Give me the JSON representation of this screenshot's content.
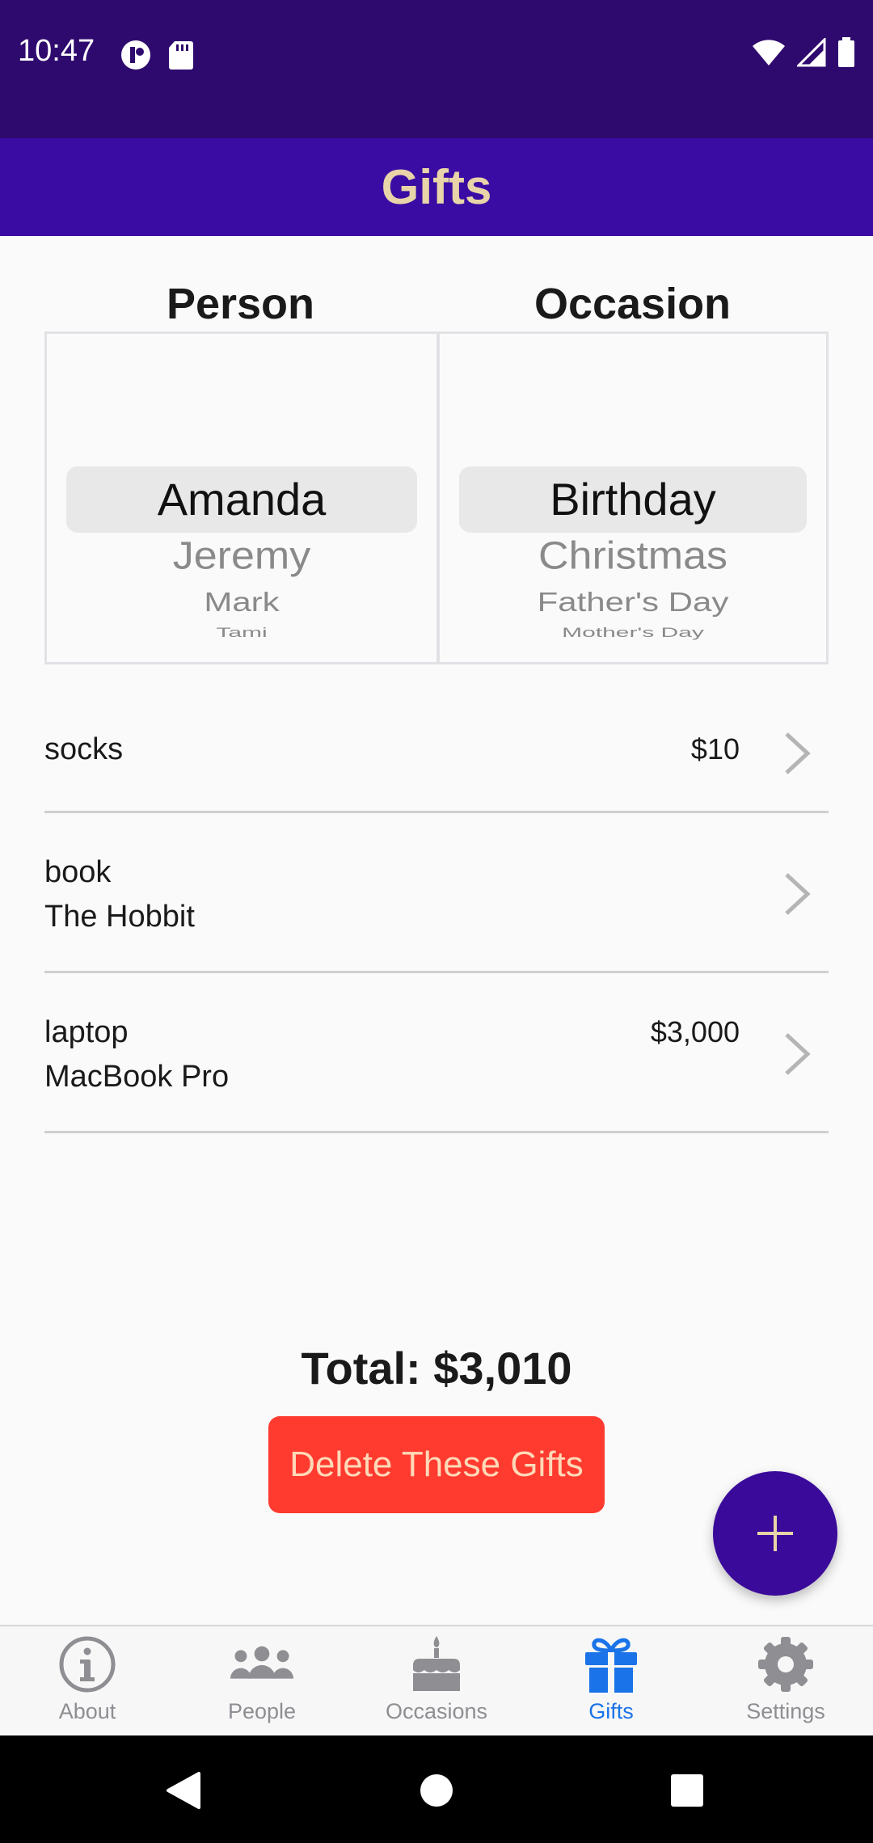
{
  "status_bar": {
    "time": "10:47",
    "left_icons": [
      "app-notification-icon",
      "sd-card-icon"
    ],
    "right_icons": [
      "wifi-icon",
      "cell-signal-icon",
      "battery-icon"
    ]
  },
  "app_bar": {
    "title": "Gifts"
  },
  "picker": {
    "person_header": "Person",
    "occasion_header": "Occasion",
    "people": [
      "Amanda",
      "Jeremy",
      "Mark",
      "Tami"
    ],
    "occasions": [
      "Birthday",
      "Christmas",
      "Father's Day",
      "Mother's Day"
    ],
    "selected_person": "Amanda",
    "selected_occasion": "Birthday"
  },
  "gifts": [
    {
      "name": "socks",
      "detail": "",
      "price": "$10"
    },
    {
      "name": "book",
      "detail": "The Hobbit",
      "price": ""
    },
    {
      "name": "laptop",
      "detail": "MacBook Pro",
      "price": "$3,000"
    }
  ],
  "total": "Total: $3,010",
  "delete_button": "Delete These Gifts",
  "fab_icon": "plus-icon",
  "tabs": [
    {
      "label": "About",
      "icon": "info-icon",
      "active": false
    },
    {
      "label": "People",
      "icon": "people-icon",
      "active": false
    },
    {
      "label": "Occasions",
      "icon": "cake-icon",
      "active": false
    },
    {
      "label": "Gifts",
      "icon": "gift-icon",
      "active": true
    },
    {
      "label": "Settings",
      "icon": "gear-icon",
      "active": false
    }
  ],
  "colors": {
    "status_bar": "#2f0a6e",
    "app_bar": "#3a0ca3",
    "title": "#e8d4a8",
    "delete_button": "#ff3b30",
    "fab": "#3a0a9a",
    "active_tab": "#1a73e8",
    "inactive_tab": "#8e8e93"
  }
}
